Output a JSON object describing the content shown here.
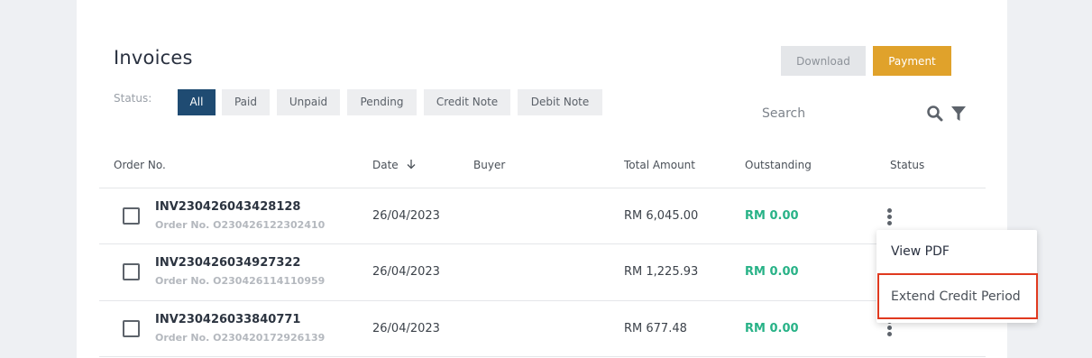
{
  "page": {
    "title": "Invoices",
    "download_label": "Download",
    "payment_label": "Payment"
  },
  "filters": {
    "label": "Status:",
    "chips": [
      "All",
      "Paid",
      "Unpaid",
      "Pending",
      "Credit Note",
      "Debit Note"
    ],
    "active": "All"
  },
  "search": {
    "placeholder": "Search"
  },
  "table": {
    "headers": [
      "Order No.",
      "Date",
      "Buyer",
      "Total Amount",
      "Outstanding",
      "Status"
    ],
    "rows": [
      {
        "invoice": "INV230426043428128",
        "order": "Order No. O230426122302410",
        "date": "26/04/2023",
        "buyer": "",
        "total": "RM 6,045.00",
        "outstanding": "RM 0.00"
      },
      {
        "invoice": "INV230426034927322",
        "order": "Order No. O230426114110959",
        "date": "26/04/2023",
        "buyer": "",
        "total": "RM 1,225.93",
        "outstanding": "RM 0.00"
      },
      {
        "invoice": "INV230426033840771",
        "order": "Order No. O230420172926139",
        "date": "26/04/2023",
        "buyer": "",
        "total": "RM 677.48",
        "outstanding": "RM 0.00"
      }
    ]
  },
  "context_menu": {
    "items": [
      "View PDF",
      "Extend Credit Period"
    ]
  },
  "colors": {
    "primary": "#1f4b72",
    "accent": "#e0a22b",
    "success": "#28b287",
    "highlight": "#e0391f"
  },
  "icons": [
    "search-icon",
    "filter-icon",
    "sort-arrow-down-icon",
    "kebab-menu-icon"
  ]
}
